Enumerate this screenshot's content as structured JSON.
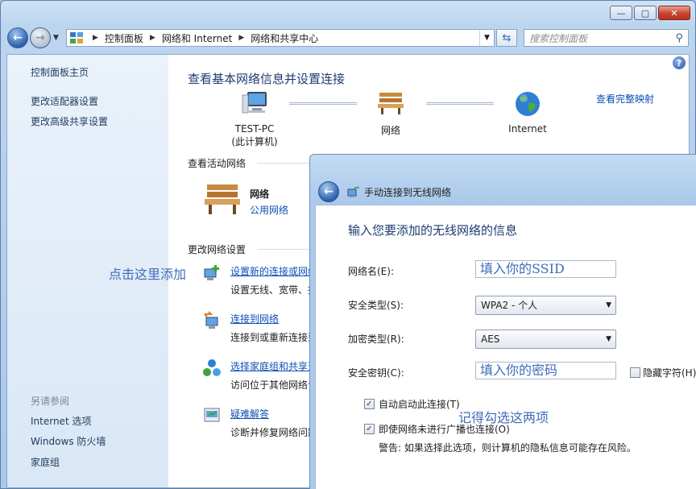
{
  "window": {
    "controls": {
      "minimize": "—",
      "maximize": "▢",
      "close": "✕"
    },
    "address": {
      "crumbs": [
        "控制面板",
        "网络和 Internet",
        "网络和共享中心"
      ]
    },
    "search": {
      "placeholder": "搜索控制面板"
    }
  },
  "sidebar": {
    "home": "控制面板主页",
    "links": [
      "更改适配器设置",
      "更改高级共享设置"
    ],
    "see_also_title": "另请参阅",
    "see_also": [
      "Internet 选项",
      "Windows 防火墙",
      "家庭组"
    ]
  },
  "main": {
    "title": "查看基本网络信息并设置连接",
    "map_link": "查看完整映射",
    "nodes": [
      {
        "label": "TEST-PC",
        "sublabel": "(此计算机)",
        "icon": "computer-icon"
      },
      {
        "label": "网络",
        "sublabel": "",
        "icon": "bench-icon"
      },
      {
        "label": "Internet",
        "sublabel": "",
        "icon": "globe-icon"
      }
    ],
    "active_networks_head": "查看活动网络",
    "active_network": {
      "name": "网络",
      "type": "公用网络"
    },
    "change_settings_head": "更改网络设置",
    "tasks": [
      {
        "link": "设置新的连接或网络",
        "desc": "设置无线、宽带、拨"
      },
      {
        "link": "连接到网络",
        "desc": "连接到或重新连接到"
      },
      {
        "link": "选择家庭组和共享选项",
        "desc": "访问位于其他网络计"
      },
      {
        "link": "疑难解答",
        "desc": "诊断并修复网络问题"
      }
    ],
    "annotation": "点击这里添加"
  },
  "dialog": {
    "title": "手动连接到无线网络",
    "heading": "输入您要添加的无线网络的信息",
    "fields": {
      "network_name_label": "网络名(E):",
      "network_name_value": "填入你的SSID",
      "security_type_label": "安全类型(S):",
      "security_type_value": "WPA2 - 个人",
      "encryption_label": "加密类型(R):",
      "encryption_value": "AES",
      "key_label": "安全密钥(C):",
      "key_value": "填入你的密码",
      "hide_chars_label": "隐藏字符(H)"
    },
    "checks": {
      "auto_start": "自动启动此连接(T)",
      "auto_start_checked": true,
      "connect_hidden": "即使网络未进行广播也连接(O)",
      "connect_hidden_checked": true,
      "hide_chars_checked": false
    },
    "warning": "警告: 如果选择此选项，则计算机的隐私信息可能存在风险。",
    "annotation": "记得勾选这两项"
  }
}
